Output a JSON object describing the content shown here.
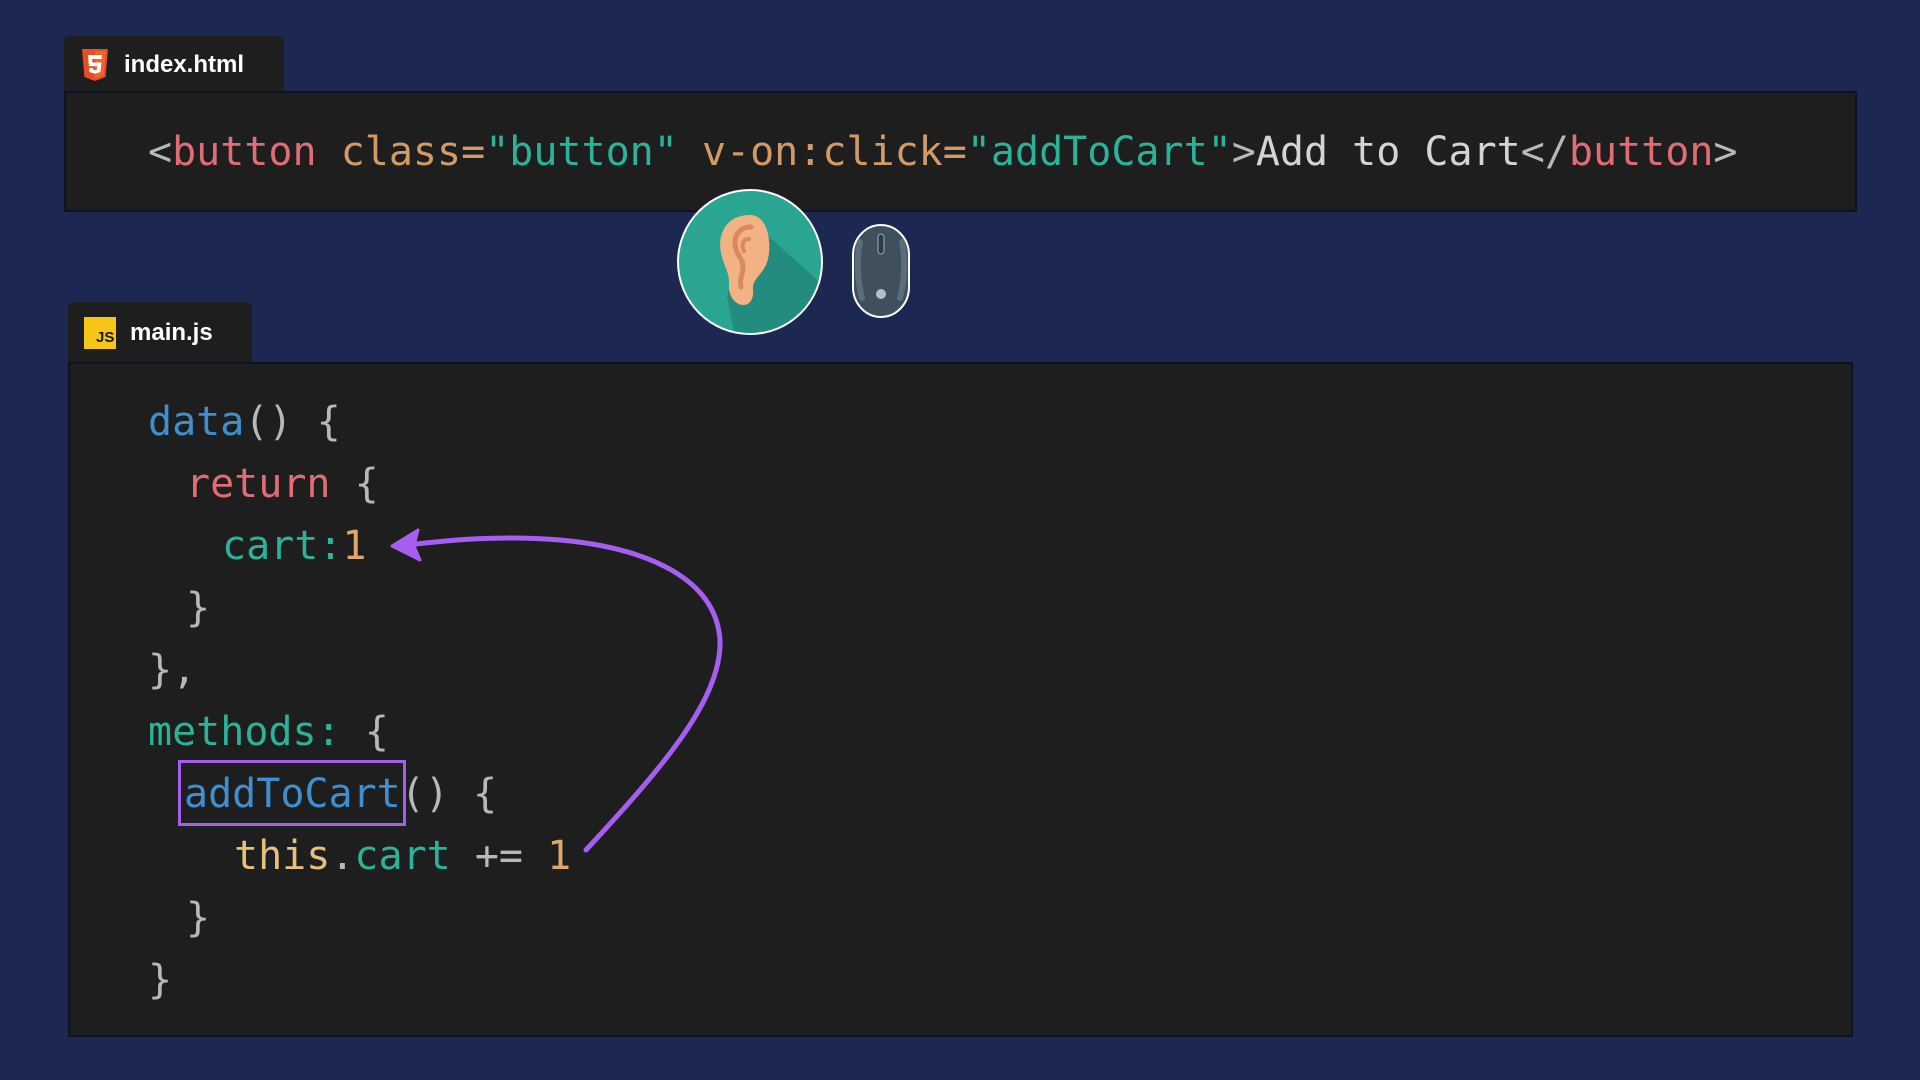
{
  "files": {
    "html": {
      "name": "index.html",
      "icon": "html5-icon",
      "line": {
        "open_bracket": "<",
        "tag": "button",
        "space1": " ",
        "attr1": "class=",
        "val1": "\"button\"",
        "space2": " ",
        "attr2": "v-on:click=",
        "val2": "\"addToCart\"",
        "close_bracket": ">",
        "text": "Add to Cart",
        "close_open": "</",
        "close_tag": "button",
        "close_end": ">"
      }
    },
    "js": {
      "name": "main.js",
      "icon": "javascript-icon",
      "badge": "JS",
      "lines": {
        "l1_fn": "data",
        "l1_rest": "() {",
        "l2_kw": "return",
        "l2_rest": " {",
        "l3_prop": "cart:",
        "l3_num": "1",
        "l4": "}",
        "l5": "},",
        "l6_prop": "methods:",
        "l6_rest": " {",
        "l7_fn": "addToCart",
        "l7_rest": "() {",
        "l8_this": "this",
        "l8_dot": ".",
        "l8_prop": "cart",
        "l8_op": " += ",
        "l8_num": "1",
        "l9": "}",
        "l10": "}"
      }
    }
  },
  "icons": {
    "listener": "ear-icon",
    "event": "mouse-icon"
  },
  "colors": {
    "background": "#1c2752",
    "editor": "#1e1e1e",
    "annotation": "#a55ef0",
    "ear_circle": "#2aa592"
  }
}
